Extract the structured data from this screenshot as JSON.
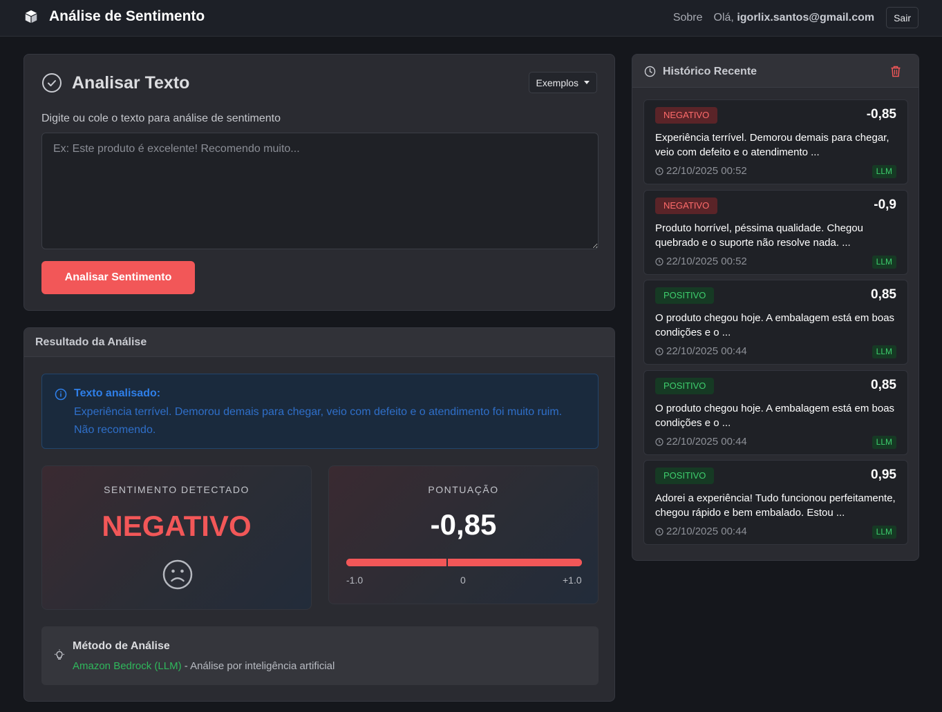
{
  "navbar": {
    "brand": "Análise de Sentimento",
    "about": "Sobre",
    "greeting": "Olá,",
    "user_email": "igorlix.santos@gmail.com",
    "logout": "Sair"
  },
  "analyze": {
    "title": "Analisar Texto",
    "examples_button": "Exemplos",
    "input_label": "Digite ou cole o texto para análise de sentimento",
    "input_placeholder": "Ex: Este produto é excelente! Recomendo muito...",
    "input_value": "",
    "submit_button": "Analisar Sentimento"
  },
  "result": {
    "header": "Resultado da Análise",
    "analyzed_label": "Texto analisado:",
    "analyzed_text": "Experiência terrível. Demorou demais para chegar, veio com defeito e o atendimento foi muito ruim. Não recomendo.",
    "sentiment_label": "SENTIMENTO DETECTADO",
    "sentiment_value": "NEGATIVO",
    "score_label": "PONTUAÇÃO",
    "score_value": "-0,85",
    "score_numeric": -0.85,
    "scale_min": "-1.0",
    "scale_mid": "0",
    "scale_max": "+1.0",
    "method_title": "Método de Análise",
    "method_name": "Amazon Bedrock (LLM)",
    "method_desc": " - Análise por inteligência artificial"
  },
  "history": {
    "title": "Histórico Recente",
    "items": [
      {
        "label": "NEGATIVO",
        "type": "neg",
        "score": "-0,85",
        "text": "Experiência terrível. Demorou demais para chegar, veio com defeito e o atendimento ...",
        "date": "22/10/2025 00:52",
        "method": "LLM"
      },
      {
        "label": "NEGATIVO",
        "type": "neg",
        "score": "-0,9",
        "text": "Produto horrível, péssima qualidade. Chegou quebrado e o suporte não resolve nada. ...",
        "date": "22/10/2025 00:52",
        "method": "LLM"
      },
      {
        "label": "POSITIVO",
        "type": "pos",
        "score": "0,85",
        "text": "O produto chegou hoje. A embalagem está em boas condições e o ...",
        "date": "22/10/2025 00:44",
        "method": "LLM"
      },
      {
        "label": "POSITIVO",
        "type": "pos",
        "score": "0,85",
        "text": "O produto chegou hoje. A embalagem está em boas condições e o ...",
        "date": "22/10/2025 00:44",
        "method": "LLM"
      },
      {
        "label": "POSITIVO",
        "type": "pos",
        "score": "0,95",
        "text": "Adorei a experiência! Tudo funcionou perfeitamente, chegou rápido e bem embalado. Estou ...",
        "date": "22/10/2025 00:44",
        "method": "LLM"
      }
    ]
  },
  "colors": {
    "accent": "#f25758",
    "positive": "#3ecf6e",
    "info": "#2f7fe8"
  },
  "icons": {
    "brand": "cube-icon",
    "analyze": "check-circle-icon",
    "info": "info-circle-icon",
    "sentiment": "sad-face-icon",
    "method": "lightbulb-icon",
    "history": "clock-icon",
    "clear_history": "trash-icon",
    "date": "clock-icon"
  }
}
